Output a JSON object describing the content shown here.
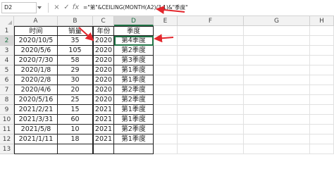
{
  "formula_bar": {
    "name_box": "D2",
    "cancel_symbol": "×",
    "enter_symbol": "✓",
    "fx_label": "fx",
    "formula": "=\"第\"&CEILING(MONTH(A2)/3,1)&\"季度\""
  },
  "columns": [
    "A",
    "B",
    "C",
    "D",
    "E",
    "F",
    "G",
    "H"
  ],
  "rows": [
    "1",
    "2",
    "3",
    "4",
    "5",
    "6",
    "7",
    "8",
    "9",
    "10",
    "11",
    "12",
    "13"
  ],
  "table": {
    "headers": [
      "时间",
      "销量",
      "年份",
      "季度"
    ],
    "data": [
      [
        "2020/10/5",
        "35",
        "2020",
        "第4季度"
      ],
      [
        "2020/5/6",
        "105",
        "2020",
        "第2季度"
      ],
      [
        "2020/7/30",
        "58",
        "2020",
        "第3季度"
      ],
      [
        "2020/1/8",
        "29",
        "2020",
        "第1季度"
      ],
      [
        "2020/2/8",
        "30",
        "2020",
        "第1季度"
      ],
      [
        "2020/4/6",
        "20",
        "2020",
        "第2季度"
      ],
      [
        "2020/5/16",
        "25",
        "2020",
        "第2季度"
      ],
      [
        "2021/2/21",
        "15",
        "2021",
        "第1季度"
      ],
      [
        "2021/3/31",
        "60",
        "2021",
        "第1季度"
      ],
      [
        "2021/5/8",
        "10",
        "2021",
        "第2季度"
      ],
      [
        "2021/1/11",
        "18",
        "2021",
        "第1季度"
      ]
    ]
  },
  "colors": {
    "accent": "#217346",
    "arrow": "#e3262c"
  }
}
